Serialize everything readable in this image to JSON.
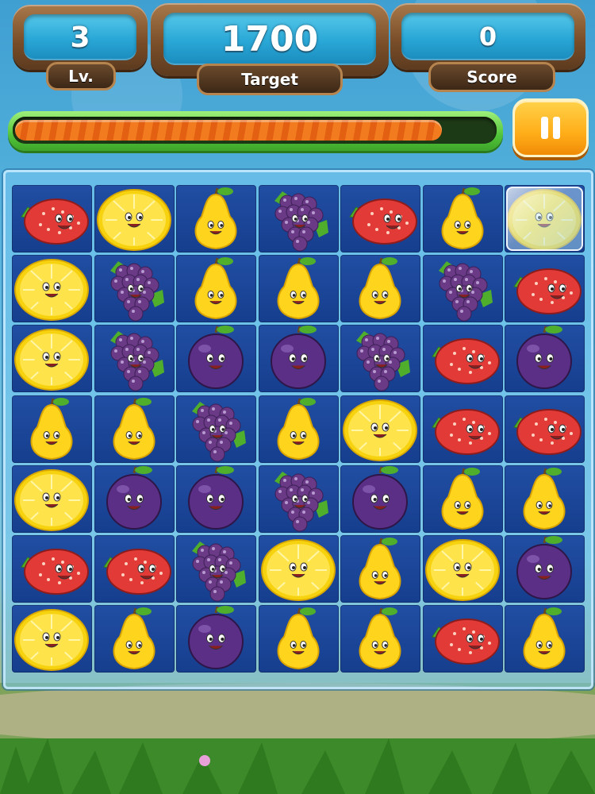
{
  "hud": {
    "level_value": "3",
    "level_label": "Lv.",
    "target_value": "1700",
    "target_label": "Target",
    "score_value": "0",
    "score_label": "Score"
  },
  "progress": {
    "fraction": 0.89
  },
  "pause_icon": "pause-icon",
  "board": {
    "rows": 7,
    "cols": 7,
    "tiles": [
      [
        "strawberry",
        "lemon",
        "pear",
        "grape",
        "strawberry",
        "pear",
        "lemon"
      ],
      [
        "lemon",
        "grape",
        "pear",
        "pear",
        "pear",
        "grape",
        "strawberry"
      ],
      [
        "lemon",
        "grape",
        "plum",
        "plum",
        "grape",
        "strawberry",
        "plum"
      ],
      [
        "pear",
        "pear",
        "grape",
        "pear",
        "lemon",
        "strawberry",
        "strawberry"
      ],
      [
        "lemon",
        "plum",
        "plum",
        "grape",
        "plum",
        "pear",
        "pear"
      ],
      [
        "strawberry",
        "strawberry",
        "grape",
        "lemon",
        "pear",
        "lemon",
        "plum"
      ],
      [
        "lemon",
        "pear",
        "plum",
        "pear",
        "pear",
        "strawberry",
        "pear"
      ]
    ],
    "frozen": [
      [
        0,
        6
      ]
    ]
  },
  "colors": {
    "strawberry": "#e23a36",
    "lemon": "#ffe34a",
    "pear": "#ffd41c",
    "grape": "#6a3a86",
    "plum": "#5b2f86",
    "leaf": "#4fae2c",
    "progress_fill": "#f27b1f"
  }
}
